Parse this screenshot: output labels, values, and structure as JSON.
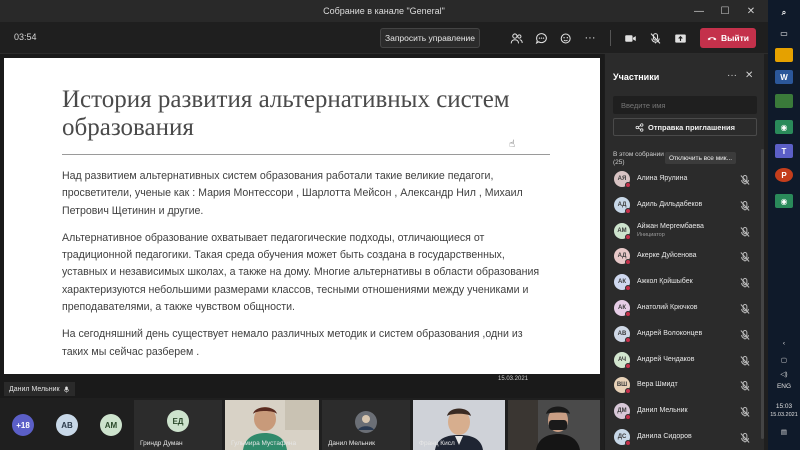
{
  "window": {
    "title": "Собрание в канале \"General\""
  },
  "toolbar": {
    "timer": "03:54",
    "request_control": "Запросить управление",
    "leave": "Выйти",
    "colors": {
      "leave": "#c4314b"
    }
  },
  "slide": {
    "title": "История развития альтернативных систем образования",
    "paragraphs": [
      "Над развитием альтернативных систем образования работали такие великие педагоги, просветители, ученые как : Мария Монтессори , Шарлотта Мейсон , Александр Нил , Михаил Петрович Щетинин и другие.",
      "Альтернативное образование охватывает педагогические подходы, отличающиеся от традиционной педагогики. Такая среда обучения может быть создана в государственных, уставных и независимых школах, а также на дому. Многие альтернативы в области образования характеризуются небольшими размерами классов, тесными отношениями между учениками и преподавателями, а также чувством общности.",
      "На сегодняшний день существует немало различных методик и систем образования ,одни из таких мы сейчас разберем ."
    ],
    "date": "15.03.2021",
    "presenter": "Данил Мельник"
  },
  "strip": {
    "more_count": "+18",
    "avatars": [
      "АВ",
      "АМ"
    ],
    "tiles": [
      {
        "initials": "ЕД",
        "name": "Гриндр Думан"
      },
      {
        "initials": "",
        "name": "Гульмира Мустафина"
      },
      {
        "initials": "",
        "name": "Данил Мельник"
      },
      {
        "initials": "",
        "name": "Франц Кисл"
      },
      {
        "initials": "",
        "name": ""
      }
    ]
  },
  "panel": {
    "title": "Участники",
    "search_placeholder": "Введите имя",
    "invite": "Отправка приглашения",
    "section": "В этом собрании (25)",
    "mute_all": "Отключить все мик...",
    "participants": [
      {
        "initials": "АЯ",
        "name": "Алина Ярулина",
        "color": "#d8c3c3"
      },
      {
        "initials": "АД",
        "name": "Адиль Дильдабеков",
        "color": "#c8d8e8"
      },
      {
        "initials": "АМ",
        "name": "Айжан Мергембаева",
        "role": "Инициатор",
        "color": "#cde3cd"
      },
      {
        "initials": "АД",
        "name": "Акерке Дуйсенова",
        "color": "#e8c8c8"
      },
      {
        "initials": "АК",
        "name": "Ажкол Қойшыбек",
        "color": "#cfd8ef"
      },
      {
        "initials": "АК",
        "name": "Анатолий Крючков",
        "color": "#e6cde6"
      },
      {
        "initials": "АВ",
        "name": "Андрей Волоконцев",
        "color": "#cfd8e6"
      },
      {
        "initials": "АЧ",
        "name": "Андрей Чендаков",
        "color": "#d3e6cf"
      },
      {
        "initials": "ВШ",
        "name": "Вера Шмидт",
        "color": "#e8d2b8"
      },
      {
        "initials": "ДМ",
        "name": "Данил Мельник",
        "color": "#d8c8d8"
      },
      {
        "initials": "ДС",
        "name": "Данила Сидоров",
        "color": "#c8d8e8"
      }
    ]
  },
  "taskbar": {
    "lang": "ENG",
    "time": "15:03",
    "date": "15.03.2021"
  }
}
